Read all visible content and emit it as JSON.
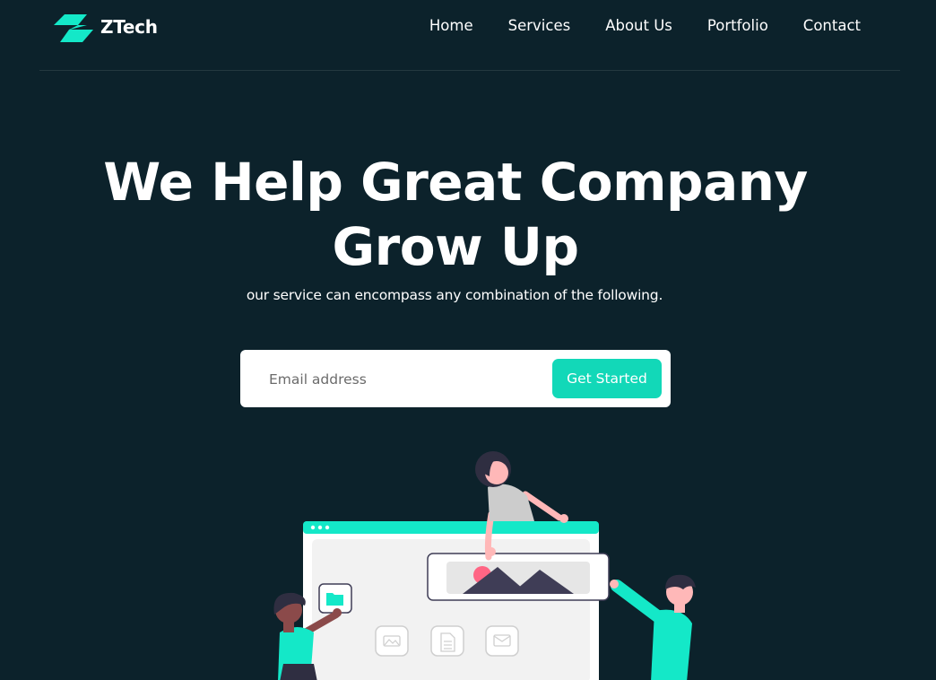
{
  "brand": {
    "name": "ZTech",
    "accent_color": "#14e8c8"
  },
  "nav": {
    "items": [
      {
        "label": "Home"
      },
      {
        "label": "Services"
      },
      {
        "label": "About Us"
      },
      {
        "label": "Portfolio"
      },
      {
        "label": "Contact"
      }
    ]
  },
  "hero": {
    "title_line1": "We Help Great Company",
    "title_line2": "Grow Up",
    "subtitle": "our service can encompass any combination of the following."
  },
  "signup": {
    "email_placeholder": "Email address",
    "email_value": "",
    "button_label": "Get Started",
    "button_color": "#12d8b8"
  },
  "illustration": {
    "icons": [
      "folder-icon",
      "image-icon",
      "document-icon",
      "mail-icon"
    ]
  }
}
